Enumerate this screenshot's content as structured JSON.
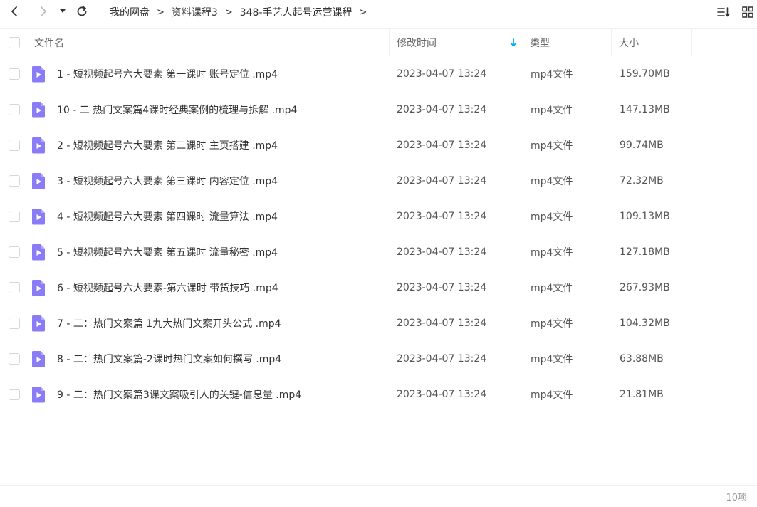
{
  "nav": {
    "back_icon": "chevron-left-icon",
    "forward_icon": "chevron-right-icon",
    "history_icon": "caret-down-icon",
    "refresh_icon": "refresh-icon"
  },
  "breadcrumb": [
    "我的网盘",
    "资料课程3",
    "348-手艺人起号运营课程"
  ],
  "breadcrumb_separator": ">",
  "toolbar": {
    "sort_icon": "sort-list-icon",
    "view_icon": "grid-view-icon"
  },
  "columns": {
    "name": "文件名",
    "modified": "修改时间",
    "type": "类型",
    "size": "大小"
  },
  "files": [
    {
      "name": "1 - 短视频起号六大要素 第一课时 账号定位 .mp4",
      "modified": "2023-04-07 13:24",
      "type": "mp4文件",
      "size": "159.70MB"
    },
    {
      "name": "10 - 二 热门文案篇4课时经典案例的梳理与拆解 .mp4",
      "modified": "2023-04-07 13:24",
      "type": "mp4文件",
      "size": "147.13MB"
    },
    {
      "name": "2 - 短视频起号六大要素 第二课时 主页搭建 .mp4",
      "modified": "2023-04-07 13:24",
      "type": "mp4文件",
      "size": "99.74MB"
    },
    {
      "name": "3 - 短视频起号六大要素 第三课时 内容定位 .mp4",
      "modified": "2023-04-07 13:24",
      "type": "mp4文件",
      "size": "72.32MB"
    },
    {
      "name": "4 - 短视频起号六大要素 第四课时 流量算法 .mp4",
      "modified": "2023-04-07 13:24",
      "type": "mp4文件",
      "size": "109.13MB"
    },
    {
      "name": "5 - 短视频起号六大要素 第五课时 流量秘密 .mp4",
      "modified": "2023-04-07 13:24",
      "type": "mp4文件",
      "size": "127.18MB"
    },
    {
      "name": "6 - 短视频起号六大要素-第六课时 带货技巧 .mp4",
      "modified": "2023-04-07 13:24",
      "type": "mp4文件",
      "size": "267.93MB"
    },
    {
      "name": "7 - 二：热门文案篇 1九大热门文案开头公式 .mp4",
      "modified": "2023-04-07 13:24",
      "type": "mp4文件",
      "size": "104.32MB"
    },
    {
      "name": "8 - 二：热门文案篇-2课时热门文案如何撰写 .mp4",
      "modified": "2023-04-07 13:24",
      "type": "mp4文件",
      "size": "63.88MB"
    },
    {
      "name": "9 - 二：热门文案篇3课文案吸引人的关键-信息量 .mp4",
      "modified": "2023-04-07 13:24",
      "type": "mp4文件",
      "size": "21.81MB"
    }
  ],
  "file_icon": "video-file-icon",
  "footer": {
    "count": "10项"
  },
  "colors": {
    "accent": "#06a7ff",
    "video_icon": "#8a7cf6",
    "divider": "#eef0f3"
  }
}
